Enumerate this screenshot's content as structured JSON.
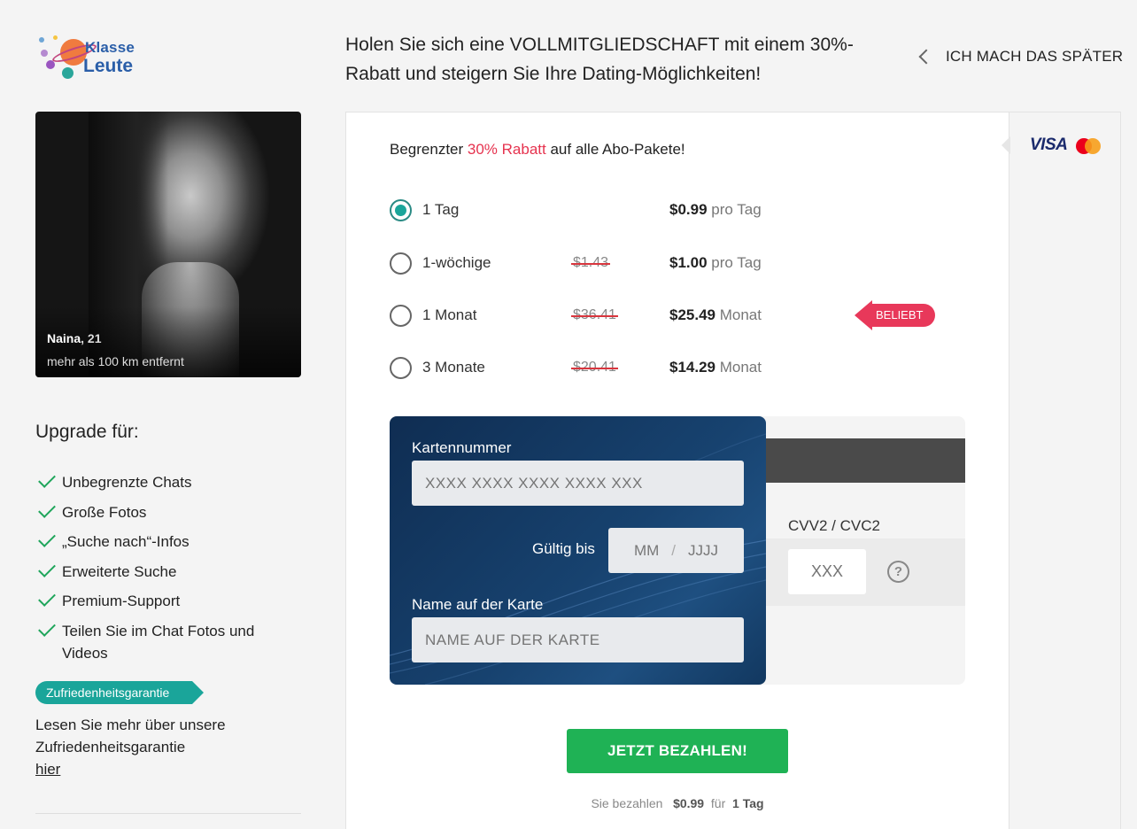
{
  "logo": {
    "line1": "Klasse",
    "line2": "Leute"
  },
  "header": {
    "headline": "Holen Sie sich eine VOLLMITGLIEDSCHAFT mit einem 30%-Rabatt und steigern Sie Ihre Dating-Möglichkeiten!",
    "later_label": "ICH MACH DAS SPÄTER"
  },
  "profile": {
    "name": "Naina",
    "age": "21",
    "distance": "mehr als 100 km entfernt"
  },
  "upgrade": {
    "title": "Upgrade für:",
    "features": [
      "Unbegrenzte Chats",
      "Große Fotos",
      "„Suche nach“-Infos",
      "Erweiterte Suche",
      "Premium-Support",
      "Teilen Sie im Chat Fotos und Videos"
    ],
    "guarantee_badge": "Zufriedenheitsgarantie",
    "read_more": "Lesen Sie mehr über unsere Zufriedenheitsgarantie",
    "read_more_link": "hier"
  },
  "payment_methods": [
    "VISA",
    "mastercard"
  ],
  "promo": {
    "prefix": "Begrenzter ",
    "highlight": "30% Rabatt",
    "suffix": " auf alle Abo-Pakete!"
  },
  "plans": [
    {
      "name": "1 Tag",
      "old_price": "",
      "price": "$0.99",
      "unit": "pro Tag",
      "selected": true
    },
    {
      "name": "1-wöchige",
      "old_price": "$1.43",
      "price": "$1.00",
      "unit": "pro Tag",
      "selected": false
    },
    {
      "name": "1 Monat",
      "old_price": "$36.41",
      "price": "$25.49",
      "unit": "Monat",
      "selected": false,
      "badge": "BELIEBT"
    },
    {
      "name": "3 Monate",
      "old_price": "$20.41",
      "price": "$14.29",
      "unit": "Monat",
      "selected": false
    }
  ],
  "card": {
    "number_label": "Kartennummer",
    "number_placeholder": "XXXX XXXX XXXX XXXX XXX",
    "expiry_label": "Gültig bis",
    "expiry_month": "MM",
    "expiry_sep": "/",
    "expiry_year": "JJJJ",
    "name_label": "Name auf der Karte",
    "name_placeholder": "NAME AUF DER KARTE",
    "cvv_label": "CVV2 / CVC2",
    "cvv_placeholder": "XXX",
    "cvv_help": "?"
  },
  "pay": {
    "button": "JETZT BEZAHLEN!",
    "summary_prefix": "Sie bezahlen",
    "summary_amount": "$0.99",
    "summary_for": "für",
    "summary_plan": "1 Tag"
  },
  "colors": {
    "accent": "#1aa59a",
    "pay_button": "#1fb255",
    "badge": "#e8385a",
    "promo_red": "#e6334f",
    "card_blue": "#17426f"
  }
}
